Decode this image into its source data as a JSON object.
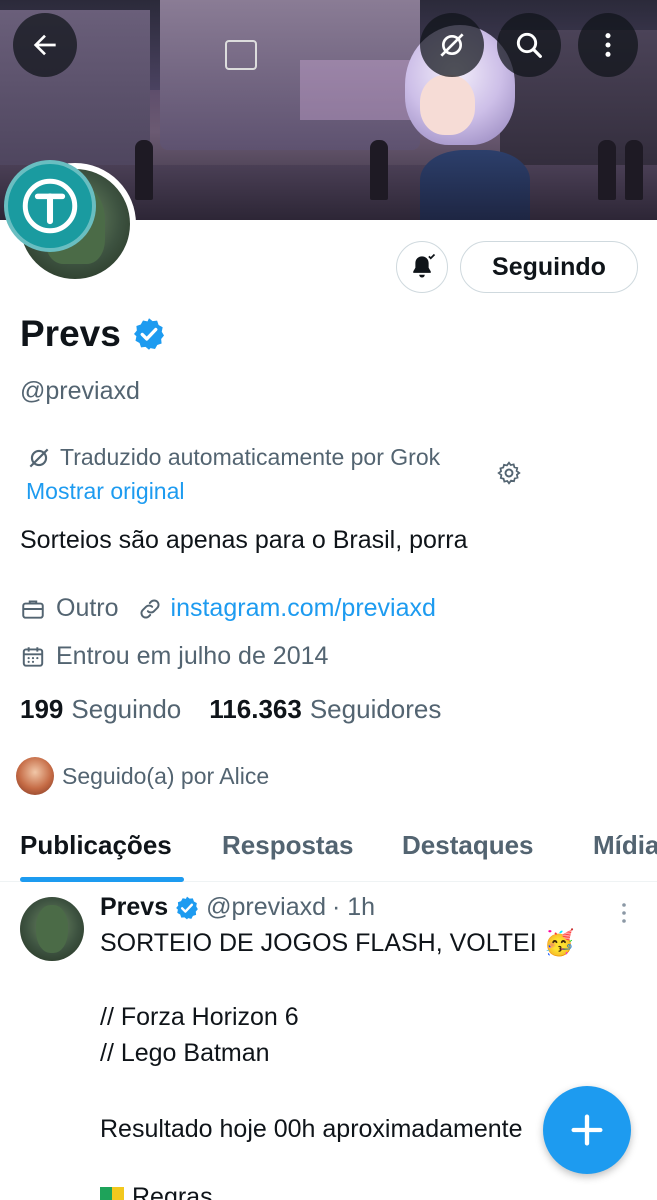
{
  "header": {
    "back_icon": "arrow-left-icon",
    "grok_icon": "grok-slash-icon",
    "search_icon": "search-icon",
    "more_icon": "more-vertical-icon"
  },
  "profile": {
    "name": "Prevs",
    "handle": "@previaxd",
    "follow_label": "Seguindo",
    "notifications_icon": "bell-check-icon",
    "translated_note": "Traduzido automaticamente por Grok",
    "show_original": "Mostrar original",
    "bio": "Sorteios são apenas para o Brasil, porra",
    "category": "Outro",
    "website": "instagram.com/previaxd",
    "joined": "Entrou em julho de 2014",
    "following_count": "199",
    "following_label": "Seguindo",
    "followers_count": "116.363",
    "followers_label": "Seguidores",
    "followed_by": "Seguido(a) por Alice"
  },
  "tabs": [
    {
      "label": "Publicações",
      "active": true
    },
    {
      "label": "Respostas",
      "active": false
    },
    {
      "label": "Destaques",
      "active": false
    },
    {
      "label": "Mídia",
      "active": false
    }
  ],
  "post": {
    "author": "Prevs",
    "handle": "@previaxd",
    "time": "· 1h",
    "lines": [
      "SORTEIO DE JOGOS FLASH, VOLTEI 🥳",
      "// Forza Horizon 6",
      "// Lego Batman",
      "Resultado hoje 00h aproximadamente",
      "Regras"
    ]
  },
  "colors": {
    "accent": "#1d9bf0",
    "text": "#0f1419",
    "secondary": "#536471",
    "grok_badge": "#1a9ba0"
  }
}
